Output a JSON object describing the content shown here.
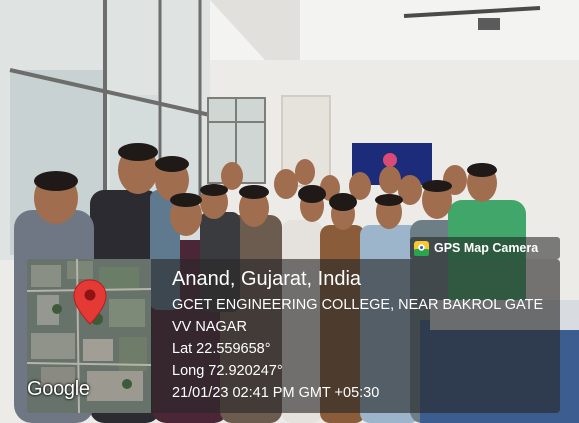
{
  "camera_badge": {
    "label": "GPS Map Camera",
    "icon": "gps-map-camera-app-icon"
  },
  "map_thumbnail": {
    "brand": "Google",
    "icon": "map-pin-icon",
    "pin_color": "#e53935"
  },
  "location": {
    "title": "Anand, Gujarat, India",
    "address_line_1": "GCET ENGINEERING COLLEGE, NEAR BAKROL GATE",
    "address_line_2": "VV NAGAR",
    "latitude": "Lat 22.559658°",
    "longitude": "Long 72.920247°",
    "timestamp": "21/01/23 02:41 PM GMT +05:30"
  }
}
